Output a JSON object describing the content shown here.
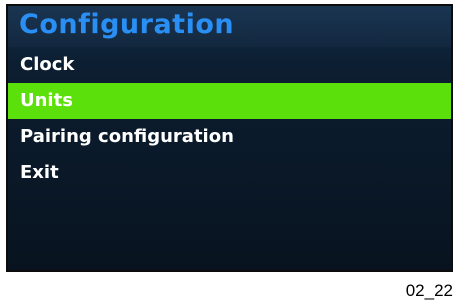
{
  "screen": {
    "title": "Configuration",
    "menu": {
      "items": [
        {
          "label": "Clock",
          "selected": false
        },
        {
          "label": "Units",
          "selected": true
        },
        {
          "label": "Pairing configuration",
          "selected": false
        },
        {
          "label": "Exit",
          "selected": false
        }
      ]
    }
  },
  "figure": {
    "caption": "02_22"
  },
  "colors": {
    "title_text": "#2a8ff5",
    "selection_highlight": "#5ce00b",
    "background": "#0c1e31"
  }
}
